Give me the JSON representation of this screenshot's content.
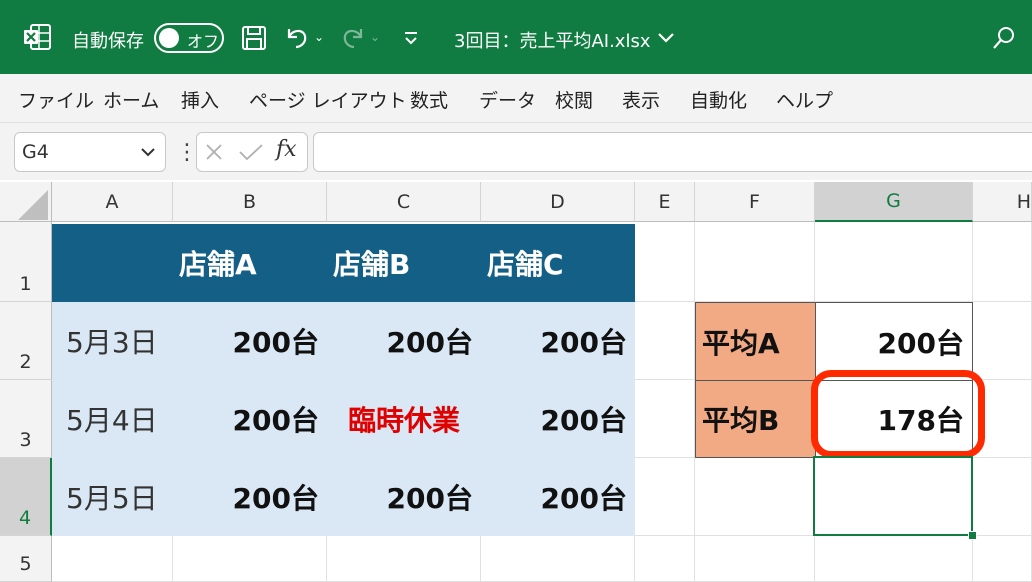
{
  "titlebar": {
    "app_label": "自動保存",
    "autosave_state": "オフ",
    "document_title": "3回目：売上平均AI.xlsx"
  },
  "menu": [
    "ファイル",
    "ホーム",
    "挿入",
    "ページ レイアウト",
    "数式",
    "データ",
    "校閲",
    "表示",
    "自動化",
    "ヘルプ"
  ],
  "formula_bar": {
    "name_box": "G4",
    "fx": "fx",
    "formula": ""
  },
  "columns": [
    "A",
    "B",
    "C",
    "D",
    "E",
    "F",
    "G",
    "H"
  ],
  "rows": [
    "1",
    "2",
    "3",
    "4",
    "5"
  ],
  "table": {
    "headers": [
      "店舗A",
      "店舗B",
      "店舗C"
    ],
    "data": [
      {
        "date": "5月3日",
        "values": [
          "200台",
          "200台",
          "200台"
        ]
      },
      {
        "date": "5月4日",
        "values": [
          "200台",
          "臨時休業",
          "200台"
        ]
      },
      {
        "date": "5月5日",
        "values": [
          "200台",
          "200台",
          "200台"
        ]
      }
    ]
  },
  "summary": [
    {
      "label": "平均A",
      "value": "200台"
    },
    {
      "label": "平均B",
      "value": "178台"
    }
  ],
  "colors": {
    "title_bar": "#107c41",
    "table_header": "#145f86",
    "table_body": "#dae8f6",
    "summary_label": "#f2aa84",
    "closed_text": "#e00000",
    "highlight": "#ff2a00"
  }
}
